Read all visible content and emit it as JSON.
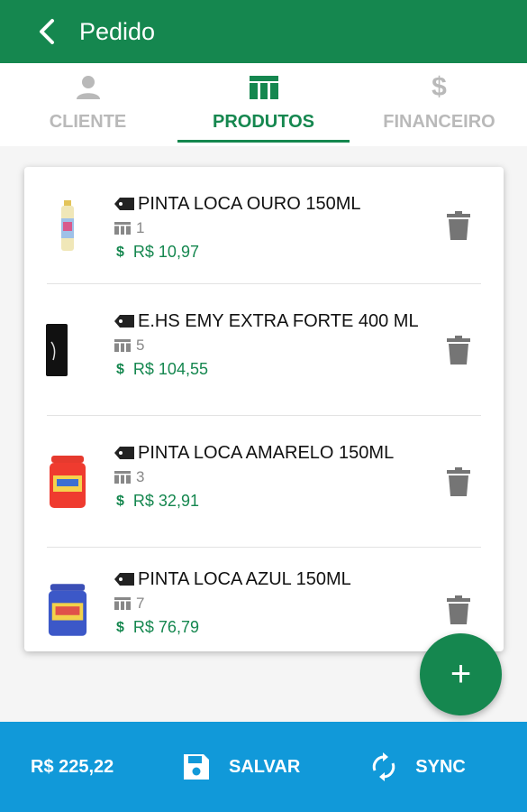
{
  "header": {
    "title": "Pedido"
  },
  "tabs": [
    {
      "label": "CLIENTE",
      "icon": "person-icon",
      "active": false
    },
    {
      "label": "PRODUTOS",
      "icon": "table-icon",
      "active": true
    },
    {
      "label": "FINANCEIRO",
      "icon": "dollar-icon",
      "active": false
    }
  ],
  "items": [
    {
      "name": "PINTA LOCA OURO 150ML",
      "qty": "1",
      "price": "R$ 10,97",
      "thumb": "spray-can-gold"
    },
    {
      "name": "E.HS EMY EXTRA FORTE 400 ML",
      "qty": "5",
      "price": "R$ 104,55",
      "thumb": "spray-can-black"
    },
    {
      "name": "PINTA LOCA AMARELO 150ML",
      "qty": "3",
      "price": "R$ 32,91",
      "thumb": "jar-red"
    },
    {
      "name": "PINTA LOCA AZUL 150ML",
      "qty": "7",
      "price": "R$ 76,79",
      "thumb": "jar-blue"
    }
  ],
  "fab": {
    "label": "+"
  },
  "footer": {
    "total": "R$ 225,22",
    "save_label": "SALVAR",
    "sync_label": "SYNC"
  },
  "colors": {
    "primary": "#15874f",
    "bottom_bar": "#1199d9",
    "inactive_tab": "#b9b9b9"
  }
}
